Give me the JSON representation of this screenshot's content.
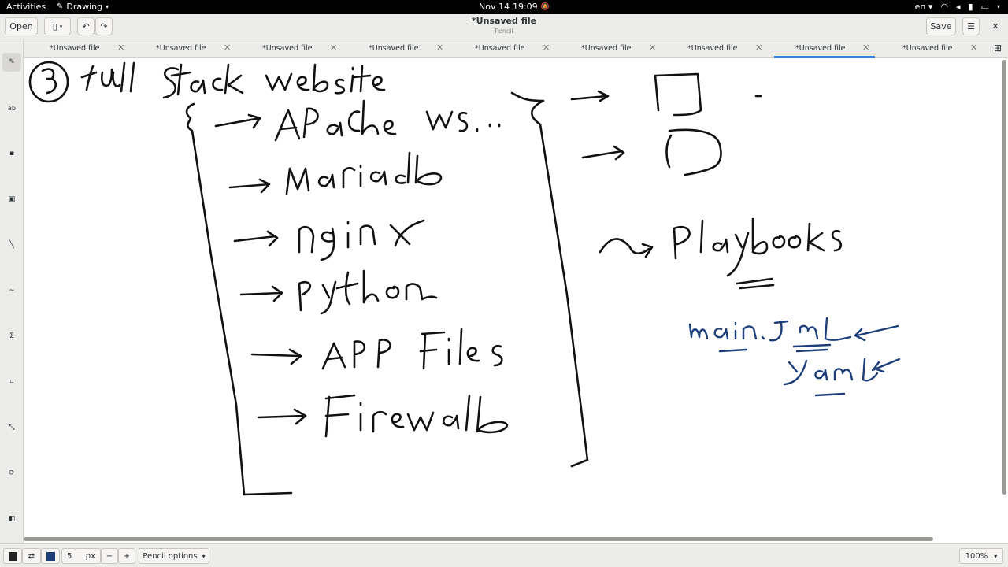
{
  "topbar": {
    "activities": "Activities",
    "app_name": "Drawing",
    "date": "Nov 14",
    "time": "19:09",
    "language": "en"
  },
  "header": {
    "open_label": "Open",
    "title": "*Unsaved file",
    "subtitle": "Pencil",
    "save_label": "Save"
  },
  "tabs": [
    {
      "label": "*Unsaved file",
      "active": false
    },
    {
      "label": "*Unsaved file",
      "active": false
    },
    {
      "label": "*Unsaved file",
      "active": false
    },
    {
      "label": "*Unsaved file",
      "active": false
    },
    {
      "label": "*Unsaved file",
      "active": false
    },
    {
      "label": "*Unsaved file",
      "active": false
    },
    {
      "label": "*Unsaved file",
      "active": false
    },
    {
      "label": "*Unsaved file",
      "active": true
    },
    {
      "label": "*Unsaved file",
      "active": false
    }
  ],
  "tools": [
    "pencil-icon",
    "text-icon",
    "rectangle-icon",
    "shape-icon",
    "line-icon",
    "curve-icon",
    "filter-icon",
    "crop-icon",
    "scale-icon",
    "rotate-icon",
    "select-icon"
  ],
  "bottombar": {
    "size_value": "5",
    "size_unit": "px",
    "minus": "−",
    "plus": "+",
    "options_label": "Pencil options",
    "zoom": "100%",
    "secondary_color": "#1c3f7a"
  },
  "drawing": {
    "ink_black": "#111111",
    "ink_blue": "#1c3f7a"
  }
}
